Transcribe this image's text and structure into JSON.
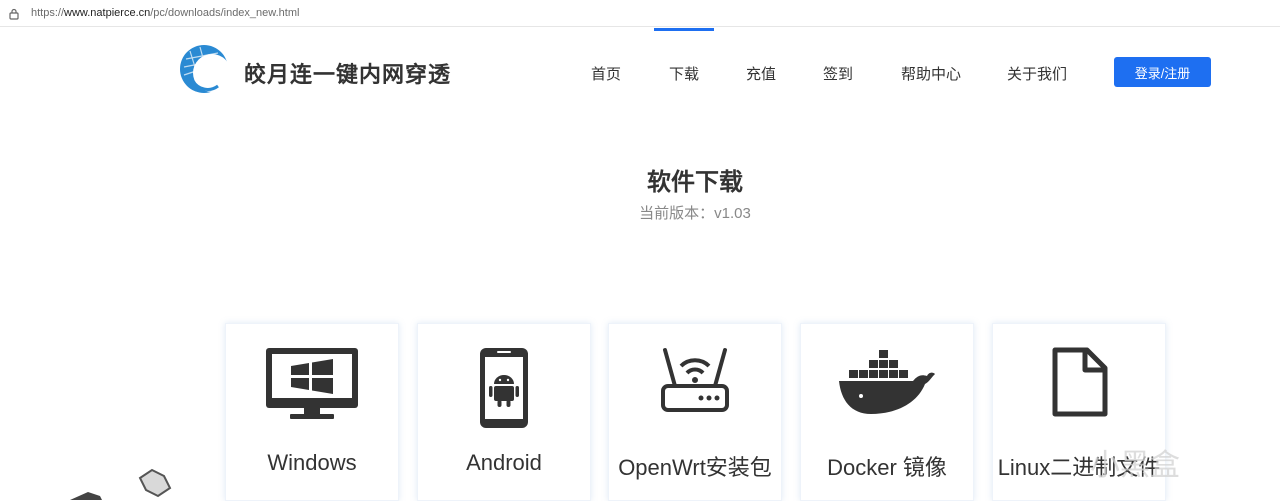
{
  "browser": {
    "url_prefix": "https://",
    "url_domain": "www.natpierce.cn",
    "url_path": "/pc/downloads/index_new.html"
  },
  "header": {
    "brand": "皎月连一键内网穿透",
    "nav": [
      {
        "label": "首页"
      },
      {
        "label": "下载"
      },
      {
        "label": "充值"
      },
      {
        "label": "签到"
      },
      {
        "label": "帮助中心"
      },
      {
        "label": "关于我们"
      }
    ],
    "active_nav": "下载",
    "login_label": "登录/注册",
    "accent_color": "#1e6ff1"
  },
  "main": {
    "title": "软件下载",
    "version_label": "当前版本：",
    "version_value": "v1.03",
    "downloads": [
      {
        "label": "Windows",
        "icon": "monitor-windows-icon"
      },
      {
        "label": "Android",
        "icon": "android-phone-icon"
      },
      {
        "label": "OpenWrt安装包",
        "icon": "router-icon"
      },
      {
        "label": "Docker 镜像",
        "icon": "docker-whale-icon"
      },
      {
        "label": "Linux二进制文件",
        "icon": "file-icon"
      }
    ]
  },
  "watermark": "小黑盒"
}
